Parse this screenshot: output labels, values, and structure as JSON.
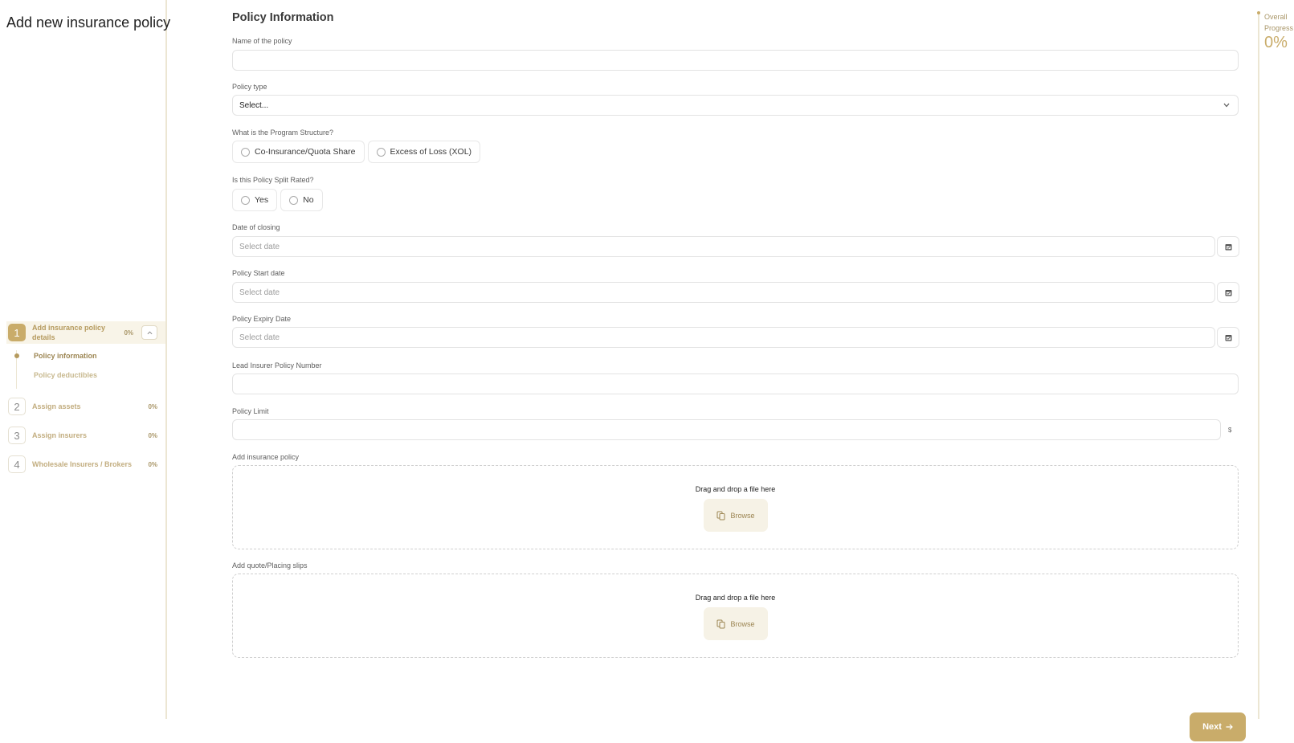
{
  "page": {
    "title": "Add new insurance policy"
  },
  "steps": [
    {
      "number": "1",
      "label": "Add insurance policy details",
      "progress": "0%",
      "active": true
    },
    {
      "number": "2",
      "label": "Assign assets",
      "progress": "0%"
    },
    {
      "number": "3",
      "label": "Assign insurers",
      "progress": "0%"
    },
    {
      "number": "4",
      "label": "Wholesale Insurers / Brokers",
      "progress": "0%"
    }
  ],
  "substeps": [
    {
      "label": "Policy information",
      "current": true
    },
    {
      "label": "Policy deductibles"
    }
  ],
  "form": {
    "section_title": "Policy Information",
    "policy_name": {
      "label": "Name of the policy",
      "value": ""
    },
    "policy_type": {
      "label": "Policy type",
      "value": "Select..."
    },
    "program_structure": {
      "label": "What is the Program Structure?",
      "options": [
        "Co-Insurance/Quota Share",
        "Excess of Loss (XOL)"
      ]
    },
    "split_rated": {
      "label": "Is this Policy Split Rated?",
      "options": [
        "Yes",
        "No"
      ]
    },
    "date_of_closing": {
      "label": "Date of closing",
      "placeholder": "Select date"
    },
    "start_date": {
      "label": "Policy Start date",
      "placeholder": "Select date"
    },
    "expiry_date": {
      "label": "Policy Expiry Date",
      "placeholder": "Select date"
    },
    "lead_policy_number": {
      "label": "Lead Insurer Policy Number",
      "value": ""
    },
    "policy_limit": {
      "label": "Policy Limit",
      "value": "",
      "currency": "$"
    },
    "upload_policy": {
      "label": "Add insurance policy",
      "drop_text": "Drag and drop a file here",
      "browse_label": "Browse"
    },
    "upload_slips": {
      "label": "Add quote/Placing slips",
      "drop_text": "Drag and drop a file here",
      "browse_label": "Browse"
    }
  },
  "overall": {
    "label": "Overall Progress",
    "value": "0%"
  },
  "next_button": {
    "label": "Next"
  },
  "colors": {
    "accent": "#c9ac6a",
    "accent_light": "#f6f2e6",
    "border": "#e3e3e3"
  }
}
